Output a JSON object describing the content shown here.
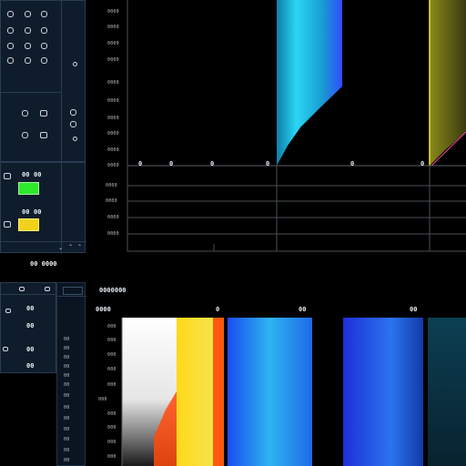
{
  "top_left": {
    "control_grid_rows": 5,
    "control_grid_cols": 4,
    "mid_controls": [
      "knob",
      "knob",
      "knob",
      "knob",
      "knob"
    ]
  },
  "status_panel": {
    "row1": "00",
    "row2": "00",
    "row3": "00",
    "row4": "00",
    "green_indicator": "#2ee82b",
    "yellow_indicator": "#f1d21a"
  },
  "bottom_left": {
    "header": "00 0000",
    "sub_header": "0000",
    "buttons": [
      "00",
      "00",
      "00",
      "00"
    ]
  },
  "top_chart": {
    "y_ticks": [
      "0000",
      "0000",
      "0000",
      "0000",
      "0000",
      "0000",
      "0000",
      "0000",
      "0000",
      "0000"
    ],
    "x_ticks": [
      "0",
      "0",
      "0",
      "0",
      "0",
      "0"
    ],
    "lower_y_ticks": [
      "0000",
      "0000",
      "0000",
      "0000"
    ],
    "band_colors": [
      "#1fb8d8",
      "#2b5fff",
      "#d2cf2a",
      "#ff2aa0"
    ]
  },
  "bottom_chart": {
    "title": "0000000",
    "left_label": "0000",
    "col1_label": "0",
    "col2_label": "00",
    "col3_label": "00",
    "y_ticks": [
      "000",
      "000",
      "000",
      "000",
      "000",
      "000",
      "000",
      "000",
      "000",
      "000",
      "000",
      "000"
    ],
    "left_ticks": [
      "00",
      "00",
      "00",
      "00",
      "00",
      "00",
      "00",
      "00",
      "00",
      "00",
      "00",
      "00",
      "00"
    ]
  }
}
